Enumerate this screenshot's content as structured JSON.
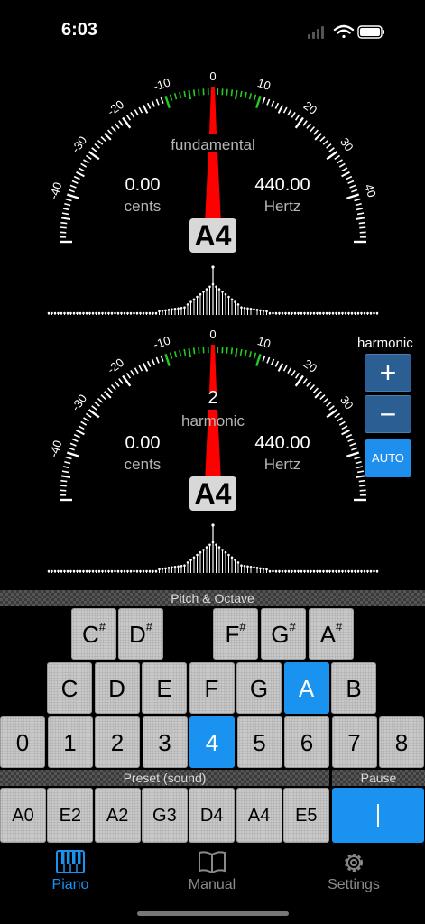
{
  "status": {
    "time": "6:03"
  },
  "meter_scale": {
    "labels": [
      "-40",
      "-30",
      "-20",
      "-10",
      "0",
      "10",
      "20",
      "30",
      "40"
    ],
    "colors": {
      "needle": "#ff0000",
      "green": "#22cc22",
      "ticks": "#ffffff"
    }
  },
  "meter1": {
    "mode_label": "fundamental",
    "cents_value": "0.00",
    "cents_unit": "cents",
    "hz_value": "440.00",
    "hz_unit": "Hertz",
    "note": "A4"
  },
  "meter2": {
    "harmonic_number": "2",
    "mode_label": "harmonic",
    "cents_value": "0.00",
    "cents_unit": "cents",
    "hz_value": "440.00",
    "hz_unit": "Hertz",
    "note": "A4"
  },
  "harmonic_panel": {
    "title": "harmonic",
    "plus": "+",
    "minus": "−",
    "auto": "AUTO"
  },
  "pitch_octave": {
    "title": "Pitch & Octave",
    "sharps": [
      {
        "base": "C",
        "sup": "#"
      },
      {
        "base": "D",
        "sup": "#"
      },
      {
        "base": "F",
        "sup": "#"
      },
      {
        "base": "G",
        "sup": "#"
      },
      {
        "base": "A",
        "sup": "#"
      }
    ],
    "naturals": [
      "C",
      "D",
      "E",
      "F",
      "G",
      "A",
      "B"
    ],
    "selected_note": "A",
    "octaves": [
      "0",
      "1",
      "2",
      "3",
      "4",
      "5",
      "6",
      "7",
      "8"
    ],
    "selected_octave": "4"
  },
  "preset": {
    "title": "Preset (sound)",
    "items": [
      "A0",
      "E2",
      "A2",
      "G3",
      "D4",
      "A4",
      "E5"
    ]
  },
  "pause": {
    "title": "Pause"
  },
  "tabs": [
    {
      "label": "Piano",
      "icon": "piano-icon",
      "active": true
    },
    {
      "label": "Manual",
      "icon": "book-icon",
      "active": false
    },
    {
      "label": "Settings",
      "icon": "gear-icon",
      "active": false
    }
  ],
  "colors": {
    "accent": "#1a92f0"
  }
}
